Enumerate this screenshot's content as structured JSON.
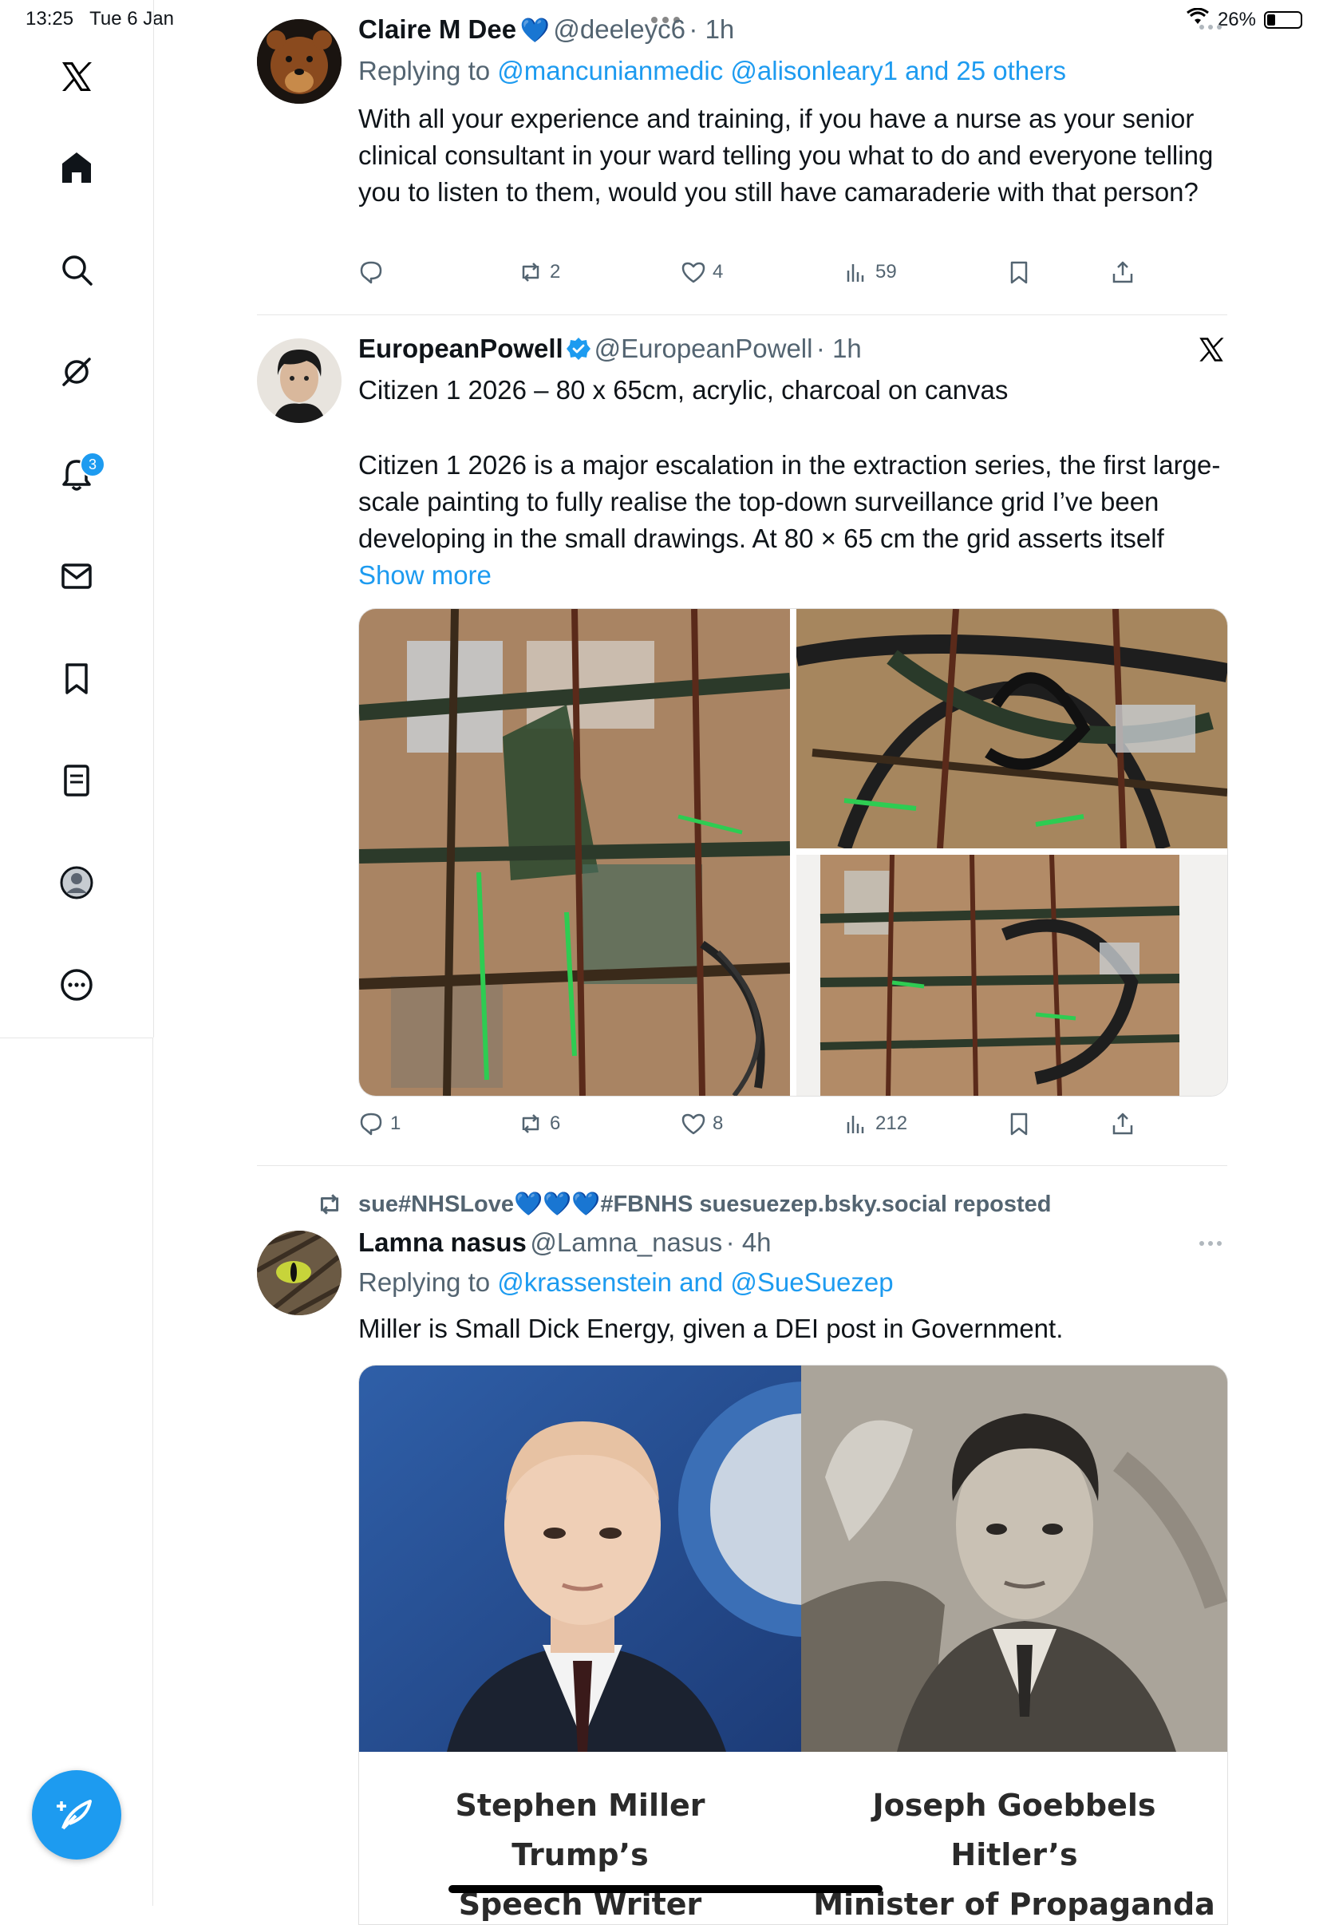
{
  "status": {
    "time": "13:25",
    "date": "Tue 6 Jan",
    "battery": "26%",
    "battery_level": 0.26
  },
  "sidebar": {
    "items": [
      {
        "name": "x-logo-icon"
      },
      {
        "name": "home-icon"
      },
      {
        "name": "search-icon"
      },
      {
        "name": "grok-icon"
      },
      {
        "name": "notifications-icon",
        "badge": "3"
      },
      {
        "name": "messages-icon"
      },
      {
        "name": "bookmarks-icon"
      },
      {
        "name": "lists-icon"
      },
      {
        "name": "profile-icon"
      },
      {
        "name": "more-icon"
      }
    ],
    "compose_icon": "compose-icon"
  },
  "tweet1": {
    "display_name": "Claire M Dee",
    "emoji": "💙",
    "handle": "@deeleyc6",
    "time": "· 1h",
    "replying_prefix": "Replying to ",
    "replying_users": "@mancunianmedic @alisonleary1 and 25 others",
    "text": "With all your experience and training, if you have a nurse as your senior clinical consultant in your ward telling you what to do and everyone telling you to listen to them, would you still have camaraderie with that person?",
    "replies": "",
    "reposts": "2",
    "likes": "4",
    "views": "59"
  },
  "tweet2": {
    "display_name": "EuropeanPowell",
    "handle": "@EuropeanPowell",
    "time": "· 1h",
    "line1": "Citizen 1 2026 – 80 x 65cm, acrylic, charcoal on canvas",
    "body": "Citizen 1 2026 is a major escalation in the extraction series, the first large-scale painting to fully realise the top-down surveillance grid I’ve been developing in the small drawings. At 80 × 65 cm the grid asserts itself",
    "show_more": "Show more",
    "replies": "1",
    "reposts": "6",
    "likes": "8",
    "views": "212"
  },
  "tweet3": {
    "reposted_by": "sue#NHSLove💙💙💙#FBNHS suesuezep.bsky.social reposted",
    "display_name": "Lamna nasus",
    "handle": "@Lamna_nasus",
    "time": "· 4h",
    "replying_prefix": "Replying to ",
    "replying_users": "@krassenstein and @SueSuezep",
    "text": "Miller is Small Dick Energy, given a DEI post in Government.",
    "caption_left_1": "Stephen Miller",
    "caption_left_2": "Trump’s",
    "caption_left_3": "Speech Writer",
    "caption_right_1": "Joseph Goebbels",
    "caption_right_2": "Hitler’s",
    "caption_right_3": "Minister of Propaganda"
  }
}
